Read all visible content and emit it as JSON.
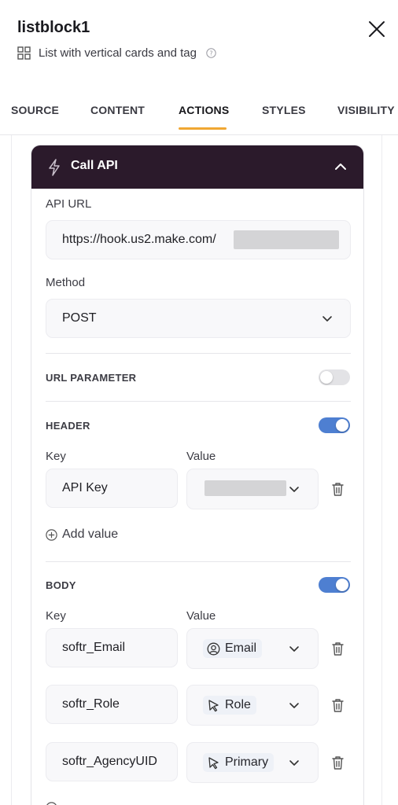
{
  "header": {
    "title": "listblock1",
    "subtitle": "List with vertical cards and tag",
    "icons": {
      "close": "close-icon",
      "block_type": "grid-icon",
      "help": "help-icon"
    }
  },
  "tabs": [
    "SOURCE",
    "CONTENT",
    "ACTIONS",
    "STYLES",
    "VISIBILITY"
  ],
  "active_tab": "ACTIONS",
  "colors": {
    "accent_underline": "#f0a733",
    "card_header": "#2b1a2b",
    "toggle_on": "#4e7fd1",
    "toggle_off": "#e3e3e6"
  },
  "action": {
    "title": "Call API",
    "icon": "bolt-icon",
    "expanded": true,
    "api_url_label": "API URL",
    "api_url_value": "https://hook.us2.make.com/",
    "method_label": "Method",
    "method_value": "POST",
    "url_parameter": {
      "label": "URL PARAMETER",
      "enabled": false
    },
    "header": {
      "label": "HEADER",
      "enabled": true,
      "key_label": "Key",
      "value_label": "Value",
      "rows": [
        {
          "key": "API Key"
        }
      ],
      "add_label": "Add value"
    },
    "body": {
      "label": "BODY",
      "enabled": true,
      "key_label": "Key",
      "value_label": "Value",
      "rows": [
        {
          "key": "softr_Email",
          "value": "Email",
          "value_icon": "user-circle-icon"
        },
        {
          "key": "softr_Role",
          "value": "Role",
          "value_icon": "cursor-icon"
        },
        {
          "key": "softr_AgencyUID",
          "value": "Primary",
          "value_icon": "cursor-icon"
        }
      ]
    }
  }
}
